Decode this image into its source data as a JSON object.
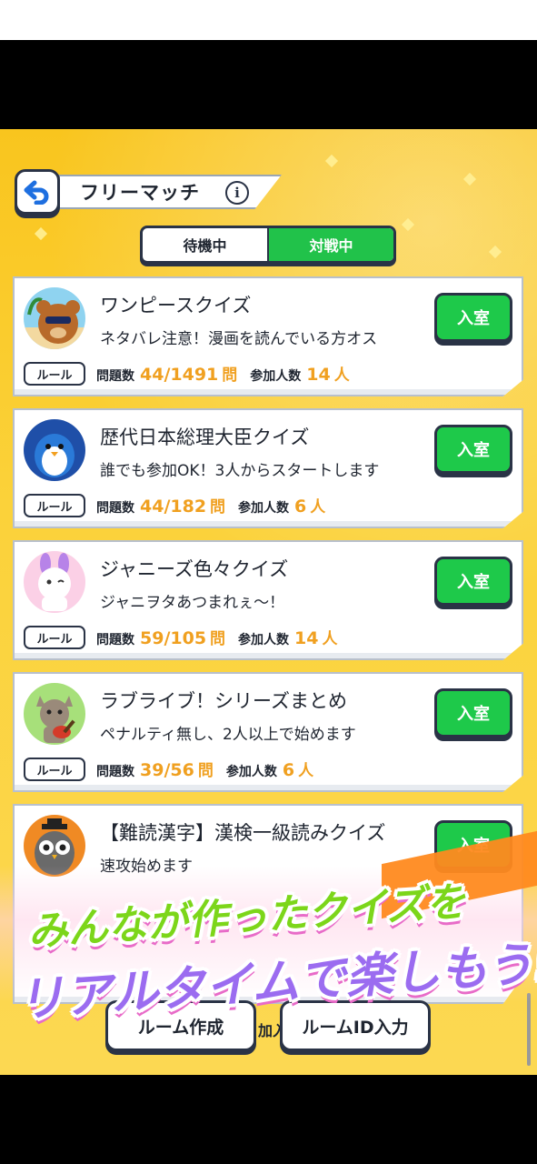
{
  "header": {
    "title": "フリーマッチ",
    "info_icon": "i"
  },
  "tabs": [
    {
      "label": "待機中",
      "active": false
    },
    {
      "label": "対戦中",
      "active": true
    }
  ],
  "labels": {
    "enter": "入室",
    "rule": "ルール",
    "questions": "問題数",
    "questions_unit": "問",
    "participants": "参加人数",
    "participants_unit": "人"
  },
  "rooms": [
    {
      "title": "ワンピースクイズ",
      "description": "ネタバレ注意！漫画を読んでいる方オス",
      "questions": "44/1491",
      "participants": "14",
      "avatar": "bear-with-sunglasses-icon"
    },
    {
      "title": "歴代日本総理大臣クイズ",
      "description": "誰でも参加OK！3人からスタートします",
      "questions": "44/182",
      "participants": "6",
      "avatar": "penguin-icon"
    },
    {
      "title": "ジャニーズ色々クイズ",
      "description": "ジャニヲタあつまれぇ〜！",
      "questions": "59/105",
      "participants": "14",
      "avatar": "bunny-character-icon"
    },
    {
      "title": "ラブライブ！シリーズまとめ",
      "description": "ペナルティ無し、2人以上で始めます",
      "questions": "39/56",
      "participants": "6",
      "avatar": "cat-with-guitar-icon"
    },
    {
      "title": "【難読漢字】漢検一級読みクイズ",
      "description": "速攻始めます",
      "avatar": "owl-icon"
    }
  ],
  "bottom_buttons": {
    "create_room": "ルーム作成",
    "room_id": "ルームID入力",
    "hidden_fragment": "加入"
  },
  "promo": {
    "line1": "みんなが作ったクイズを",
    "line2": "リアルタイムで楽しもう!"
  },
  "colors": {
    "background": "#f9c51e",
    "enter_button": "#1ec94a",
    "stat_value": "#f0a020"
  }
}
